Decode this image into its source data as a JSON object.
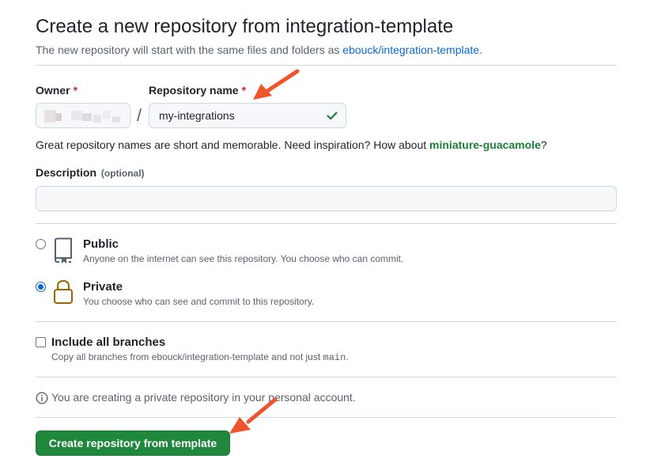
{
  "header": {
    "title": "Create a new repository from integration-template",
    "subtitle_prefix": "The new repository will start with the same files and folders as ",
    "template_link": "ebouck/integration-template",
    "subtitle_suffix": "."
  },
  "owner": {
    "label": "Owner",
    "required_mark": "*",
    "value": "",
    "blurred": true
  },
  "separator": "/",
  "repo_name": {
    "label": "Repository name",
    "required_mark": "*",
    "value": "my-integrations",
    "valid": true,
    "valid_icon": "check-icon"
  },
  "hint": {
    "text": "Great repository names are short and memorable. Need inspiration? How about ",
    "suggestion": "miniature-guacamole",
    "suffix": "?"
  },
  "description": {
    "label": "Description",
    "optional": "(optional)",
    "value": ""
  },
  "visibility": {
    "selected": "Private",
    "options": [
      {
        "title": "Public",
        "description": "Anyone on the internet can see this repository. You choose who can commit.",
        "icon": "repo-icon",
        "checked": false
      },
      {
        "title": "Private",
        "description": "You choose who can see and commit to this repository.",
        "icon": "lock-icon",
        "checked": true
      }
    ]
  },
  "branches": {
    "title": "Include all branches",
    "description_prefix": "Copy all branches from ebouck/integration-template and not just ",
    "branch": "main",
    "description_suffix": ".",
    "checked": false
  },
  "notice": {
    "icon": "info-icon",
    "text": "You are creating a private repository in your personal account."
  },
  "submit": {
    "label": "Create repository from template"
  },
  "colors": {
    "accent": "#0969da",
    "success": "#1a7f37",
    "button": "#1f883d",
    "annotation_arrow": "#f0542c",
    "lock_icon": "#9a6700"
  },
  "annotations": [
    "arrow-to-repo-name",
    "arrow-to-create-button"
  ]
}
